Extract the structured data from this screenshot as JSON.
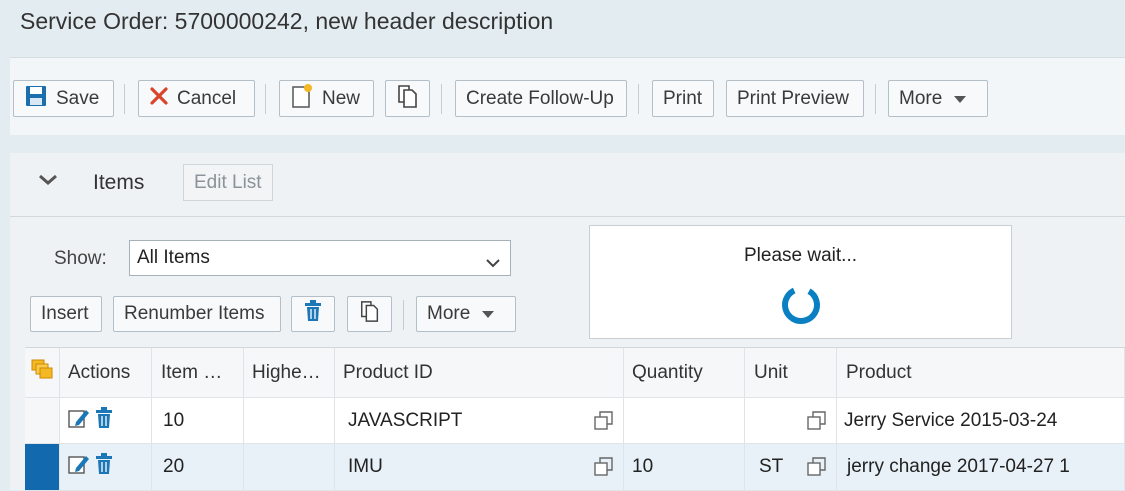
{
  "window": {
    "title": "Service Order: 5700000242, new header description"
  },
  "toolbar": {
    "save_label": "Save",
    "cancel_label": "Cancel",
    "new_label": "New",
    "create_follow_up_label": "Create Follow-Up",
    "print_label": "Print",
    "print_preview_label": "Print Preview",
    "more_label": "More"
  },
  "items_panel": {
    "title": "Items",
    "edit_list_label": "Edit List",
    "show_label": "Show:",
    "show_value": "All Items",
    "insert_label": "Insert",
    "renumber_label": "Renumber Items",
    "more_label": "More",
    "busy_message": "Please wait..."
  },
  "table": {
    "columns": [
      "Actions",
      "Item …",
      "Highe…",
      "Product ID",
      "Quantity",
      "Unit",
      "Product"
    ],
    "rows": [
      {
        "item": "10",
        "higher": "",
        "product_id": "JAVASCRIPT",
        "quantity": "",
        "unit": "",
        "product": "Jerry Service 2015-03-24"
      },
      {
        "item": "20",
        "higher": "",
        "product_id": "IMU",
        "quantity": "10",
        "unit": "ST",
        "product": "jerry change 2017-04-27 1"
      }
    ]
  },
  "colors": {
    "accent": "#1b77b6",
    "cancel_red": "#d9452b",
    "selection_bar": "#1369ad",
    "spinner": "#0a7fc2"
  }
}
